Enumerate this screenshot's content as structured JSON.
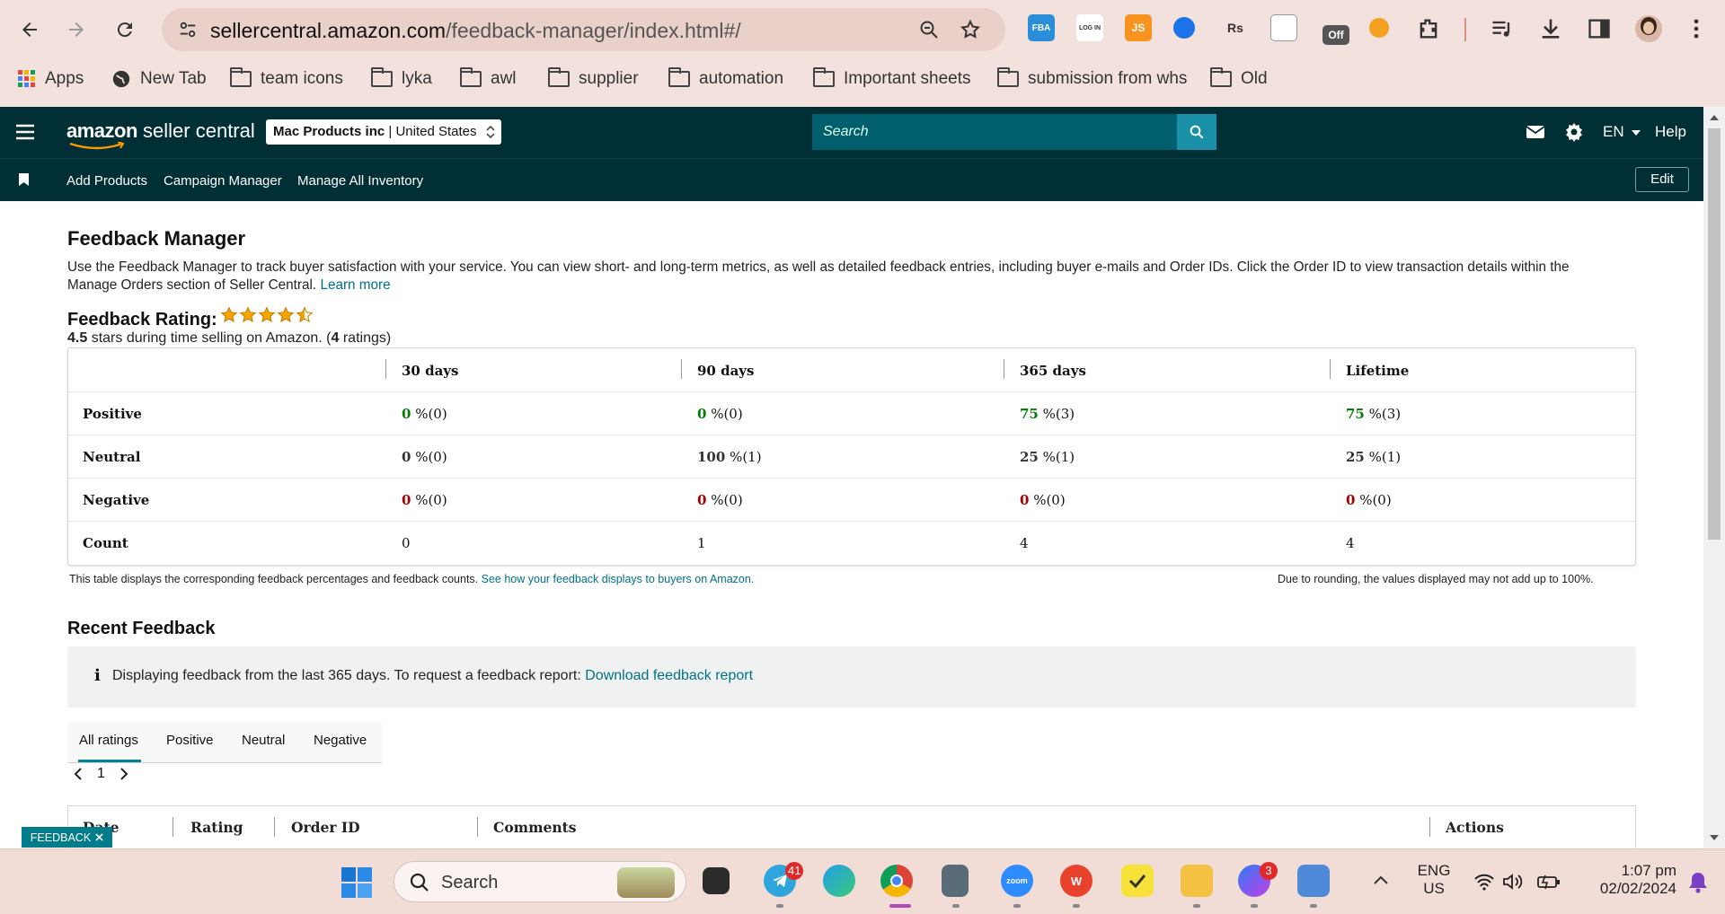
{
  "browser": {
    "url_domain": "sellercentral.amazon.com",
    "url_path": "/feedback-manager/index.html#/",
    "extensions": [
      "FBA",
      "LOG IN",
      "JS",
      "Rs",
      "Off"
    ],
    "bookmarks": [
      "Apps",
      "New Tab",
      "team icons",
      "lyka",
      "awl",
      "supplier",
      "automation",
      "Important sheets",
      "submission from whs",
      "Old"
    ]
  },
  "header": {
    "logo_bold": "amazon",
    "logo_light": " seller central",
    "merchant_name": "Mac Products inc",
    "merchant_sep": " | ",
    "merchant_region": "United States",
    "search_placeholder": "Search",
    "language": "EN",
    "help": "Help",
    "subnav": [
      "Add Products",
      "Campaign Manager",
      "Manage All Inventory"
    ],
    "edit": "Edit"
  },
  "page": {
    "title": "Feedback Manager",
    "intro": "Use the Feedback Manager to track buyer satisfaction with your service. You can view short- and long-term metrics, as well as detailed feedback entries, including buyer e-mails and Order IDs. Click the Order ID to view transaction details within the Manage Orders section of Seller Central.",
    "learn_more": "Learn more",
    "rating_title": "Feedback Rating:",
    "rating_value": "4.5",
    "rating_text": " stars during time selling on Amazon. (",
    "rating_count": "4",
    "rating_suffix": " ratings)",
    "stars_rating": 4.5
  },
  "table": {
    "columns": [
      "30 days",
      "90 days",
      "365 days",
      "Lifetime"
    ],
    "rows": [
      {
        "label": "Positive",
        "cells": [
          {
            "v": "0",
            "r": " %(0)"
          },
          {
            "v": "0",
            "r": " %(0)"
          },
          {
            "v": "75",
            "r": " %(3)"
          },
          {
            "v": "75",
            "r": " %(3)"
          }
        ]
      },
      {
        "label": "Neutral",
        "cells": [
          {
            "v": "0",
            "r": " %(0)"
          },
          {
            "v": "100",
            "r": " %(1)"
          },
          {
            "v": "25",
            "r": " %(1)"
          },
          {
            "v": "25",
            "r": " %(1)"
          }
        ]
      },
      {
        "label": "Negative",
        "cells": [
          {
            "v": "0",
            "r": " %(0)"
          },
          {
            "v": "0",
            "r": " %(0)"
          },
          {
            "v": "0",
            "r": " %(0)"
          },
          {
            "v": "0",
            "r": " %(0)"
          }
        ]
      },
      {
        "label": "Count",
        "cells": [
          {
            "v": "0",
            "r": ""
          },
          {
            "v": "1",
            "r": ""
          },
          {
            "v": "4",
            "r": ""
          },
          {
            "v": "4",
            "r": ""
          }
        ]
      }
    ],
    "note_left": "This table displays the corresponding feedback percentages and feedback counts.",
    "note_link": "See how your feedback displays to buyers on Amazon.",
    "note_right": "Due to rounding, the values displayed may not add up to 100%."
  },
  "recent": {
    "title": "Recent Feedback",
    "info_text": "Displaying feedback from the last 365 days. To request a feedback report:",
    "info_link": "Download feedback report",
    "tabs": [
      "All ratings",
      "Positive",
      "Neutral",
      "Negative"
    ],
    "page": "1",
    "list_columns": [
      "Date",
      "Rating",
      "Order ID",
      "Comments",
      "Actions"
    ],
    "feedback_button": "FEEDBACK"
  },
  "taskbar": {
    "search": "Search",
    "telegram_badge": "41",
    "messenger_badge": "3",
    "lang_top": "ENG",
    "lang_bottom": "US",
    "time": "1:07 pm",
    "date": "02/02/2024",
    "zoom": "zoom"
  },
  "colors": {
    "header_bg": "#002f36",
    "search_bg": "#005f6d",
    "link": "#007185",
    "positive": "#067d06",
    "negative": "#a50000",
    "star": "#f7a600"
  }
}
